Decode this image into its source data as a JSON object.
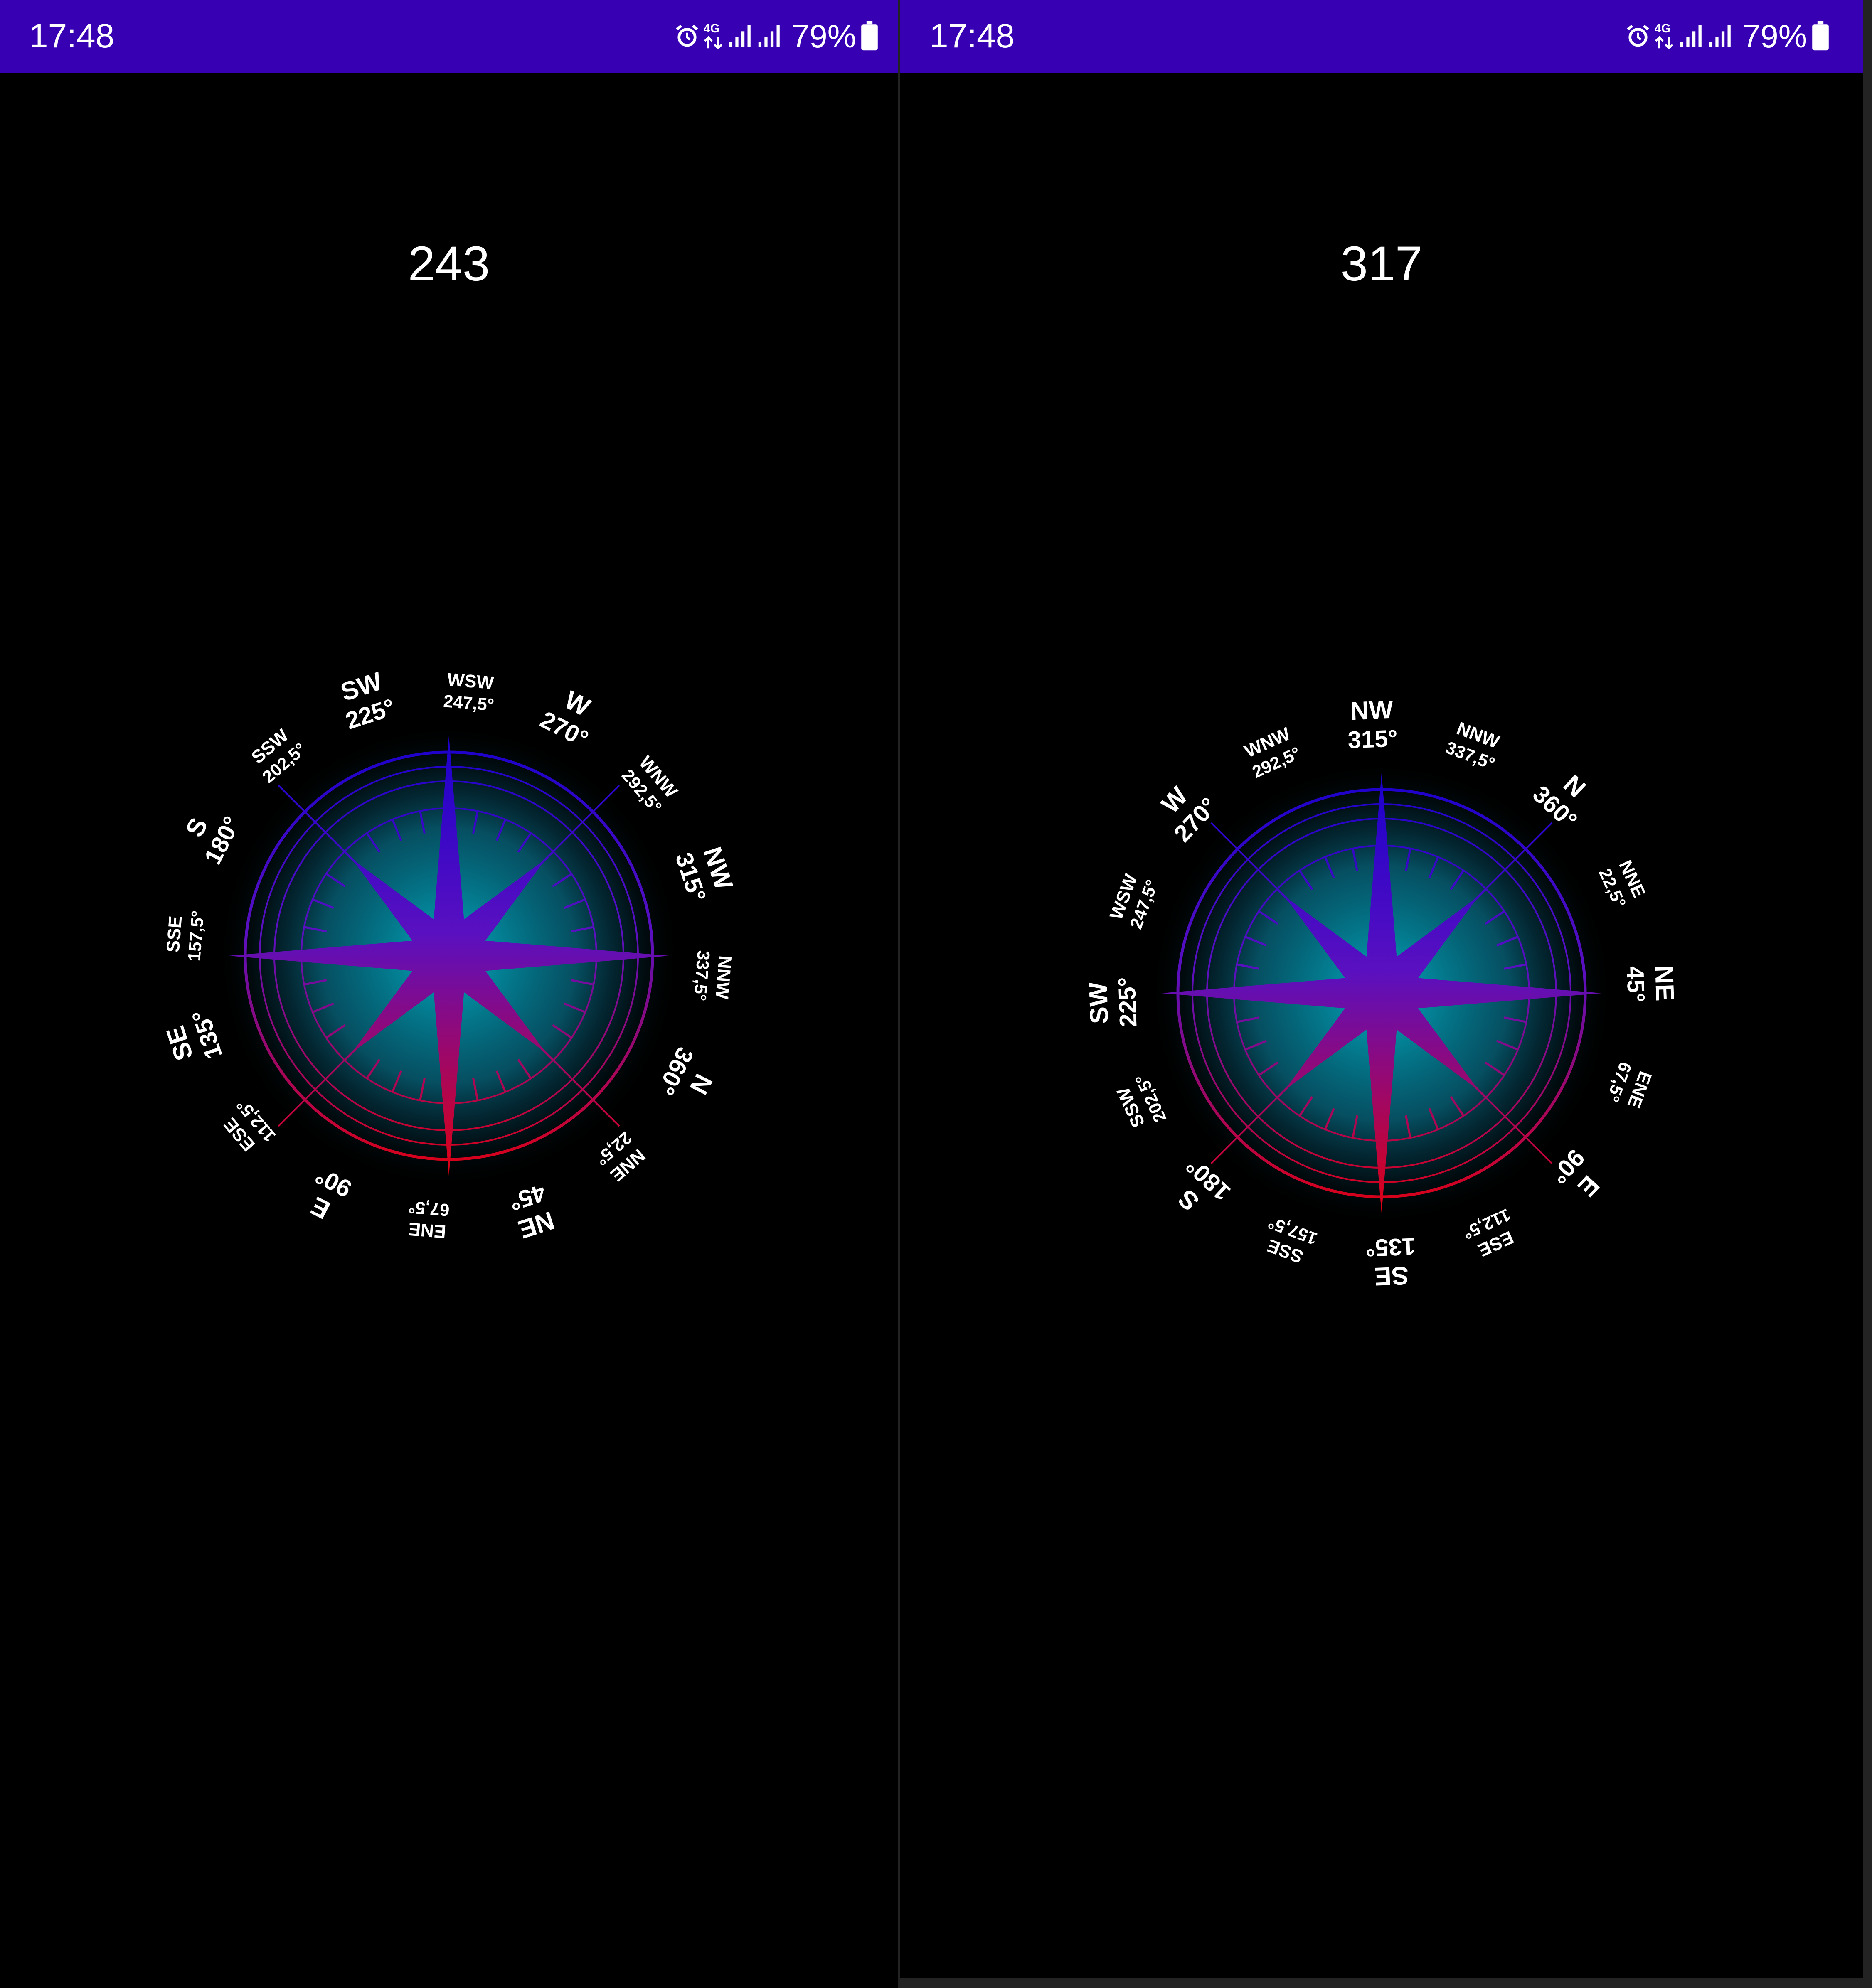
{
  "screens": [
    {
      "status_bar": {
        "time": "17:48",
        "battery": "79%",
        "icons": [
          "alarm-icon",
          "network-4g-icon",
          "signal-icon",
          "signal-icon",
          "battery-icon"
        ]
      },
      "heading": "243",
      "compass": {
        "rotation_deg": 117
      }
    },
    {
      "status_bar": {
        "time": "17:48",
        "battery": "79%",
        "icons": [
          "alarm-icon",
          "network-4g-icon",
          "signal-icon",
          "signal-icon",
          "battery-icon"
        ]
      },
      "heading": "317",
      "compass": {
        "rotation_deg": 43
      }
    }
  ],
  "compass_labels": [
    {
      "name": "N",
      "degree": "360°"
    },
    {
      "name": "NNE",
      "degree": "22,5°"
    },
    {
      "name": "NE",
      "degree": "45°"
    },
    {
      "name": "ENE",
      "degree": "67,5°"
    },
    {
      "name": "E",
      "degree": "90°"
    },
    {
      "name": "ESE",
      "degree": "112,5°"
    },
    {
      "name": "SE",
      "degree": "135°"
    },
    {
      "name": "SSE",
      "degree": "157,5°"
    },
    {
      "name": "S",
      "degree": "180°"
    },
    {
      "name": "SSW",
      "degree": "202,5°"
    },
    {
      "name": "SW",
      "degree": "225°"
    },
    {
      "name": "WSW",
      "degree": "247,5°"
    },
    {
      "name": "W",
      "degree": "270°"
    },
    {
      "name": "WNW",
      "degree": "292,5°"
    },
    {
      "name": "NW",
      "degree": "315°"
    },
    {
      "name": "NNW",
      "degree": "337,5°"
    }
  ],
  "colors": {
    "status_bar": "#3700b3",
    "background": "#000000",
    "rose_top": "#1a00cc",
    "rose_bottom": "#e00010",
    "glow": "#00c8e0",
    "text": "#ffffff"
  }
}
